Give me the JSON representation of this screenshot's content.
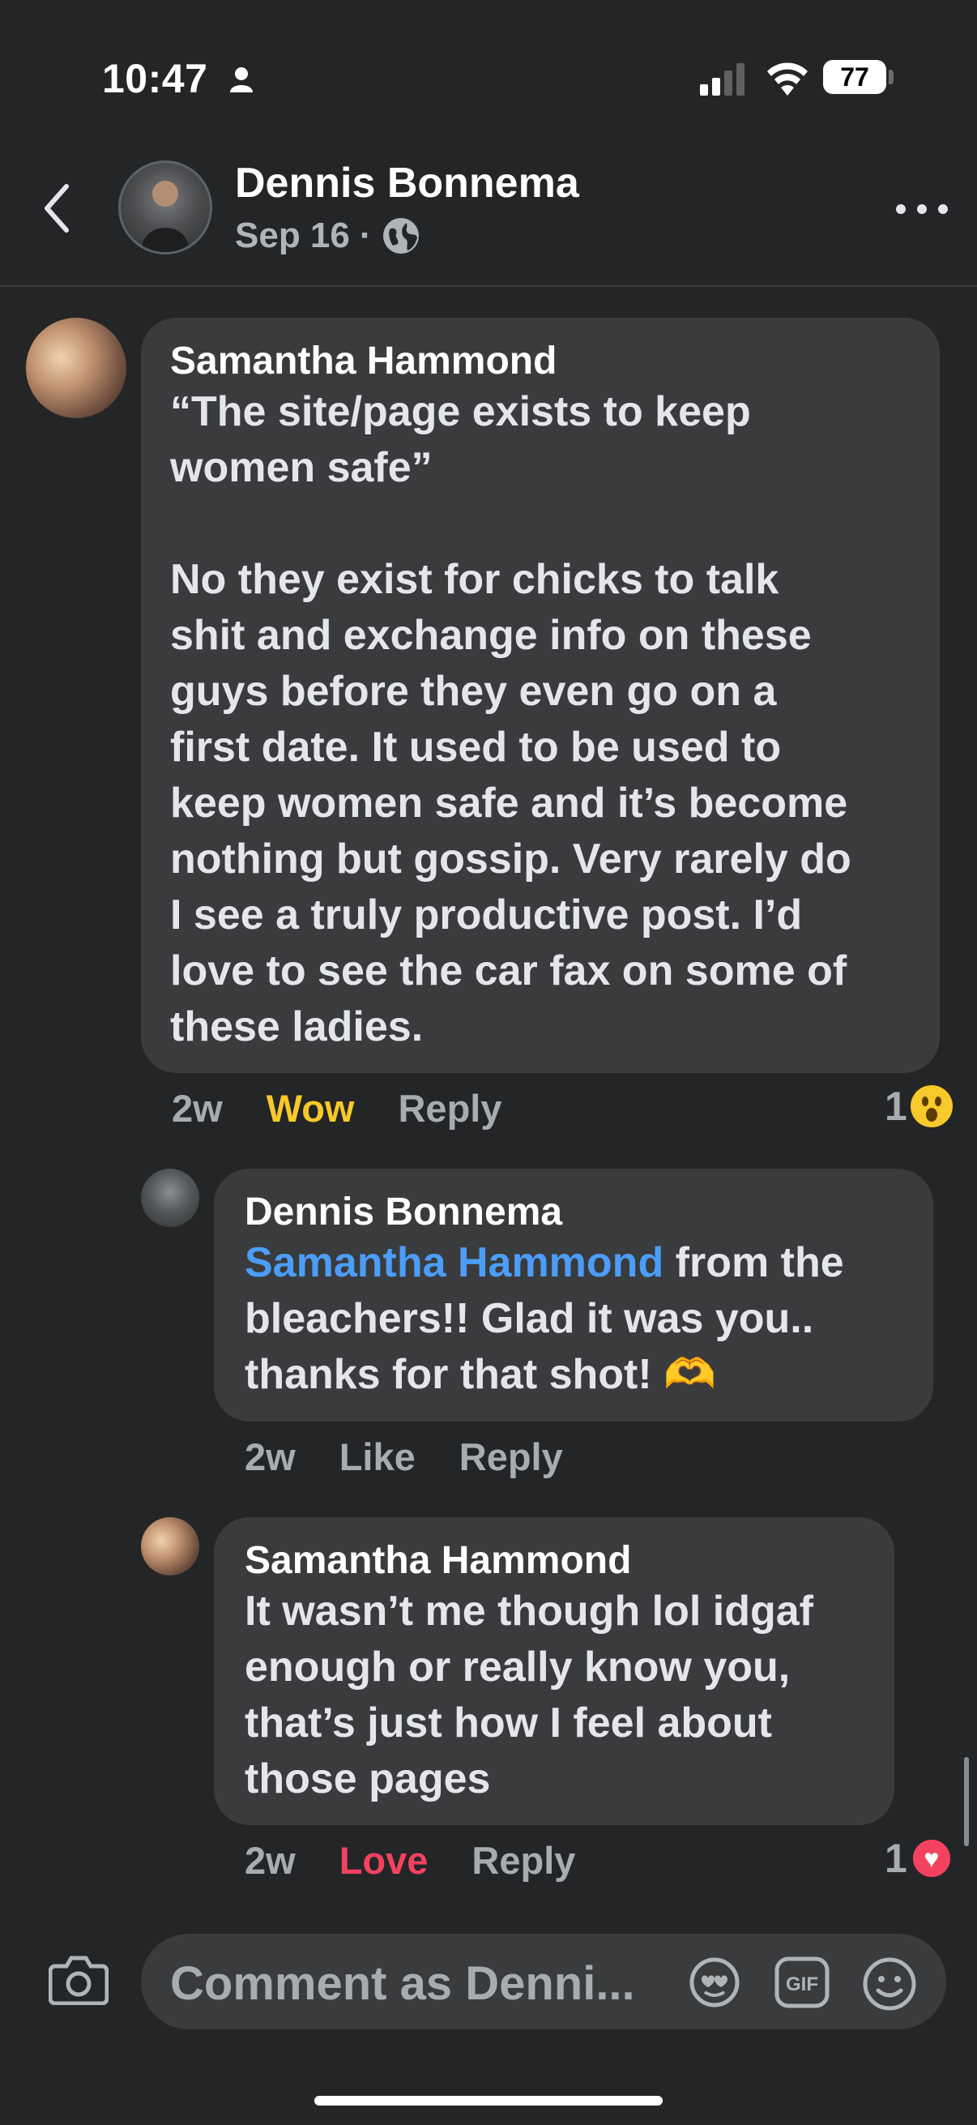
{
  "status": {
    "time": "10:47",
    "battery": "77"
  },
  "header": {
    "name": "Dennis Bonnema",
    "date": "Sep 16",
    "separator": "·",
    "privacy_icon": "globe-icon"
  },
  "comments": [
    {
      "author": "Samantha Hammond",
      "text": "“The site/page exists to keep\nwomen safe”\n\nNo they exist for chicks to talk\nshit and exchange info on these\nguys before they even go on a\nfirst date. It used to be used to\nkeep women safe and it’s become\nnothing but gossip. Very rarely do\nI see a truly productive post. I’d\nlove to see the car fax on some of\nthese ladies.",
      "time": "2w",
      "reaction_action": "Wow",
      "reply": "Reply",
      "reaction_count": "1",
      "reaction_icon": "wow-emoji-icon"
    },
    {
      "author": "Dennis Bonnema",
      "mention": "Samantha Hammond",
      "text_after_mention": " from the",
      "text_rest": "bleachers!! Glad it was you..\nthanks for that shot! 🫶",
      "time": "2w",
      "reaction_action": "Like",
      "reply": "Reply"
    },
    {
      "author": "Samantha Hammond",
      "text": "It wasn’t me though lol idgaf\nenough or really know you,\nthat’s just how I feel about\nthose pages",
      "time": "2w",
      "reaction_action": "Love",
      "reply": "Reply",
      "reaction_count": "1",
      "reaction_icon": "love-heart-icon"
    }
  ],
  "composer": {
    "placeholder": "Comment as Denni..."
  },
  "colors": {
    "background": "#242526",
    "bubble": "#3a3b3c",
    "mention": "#4b9df8",
    "wow": "#f7c92a",
    "love": "#f3425f"
  }
}
